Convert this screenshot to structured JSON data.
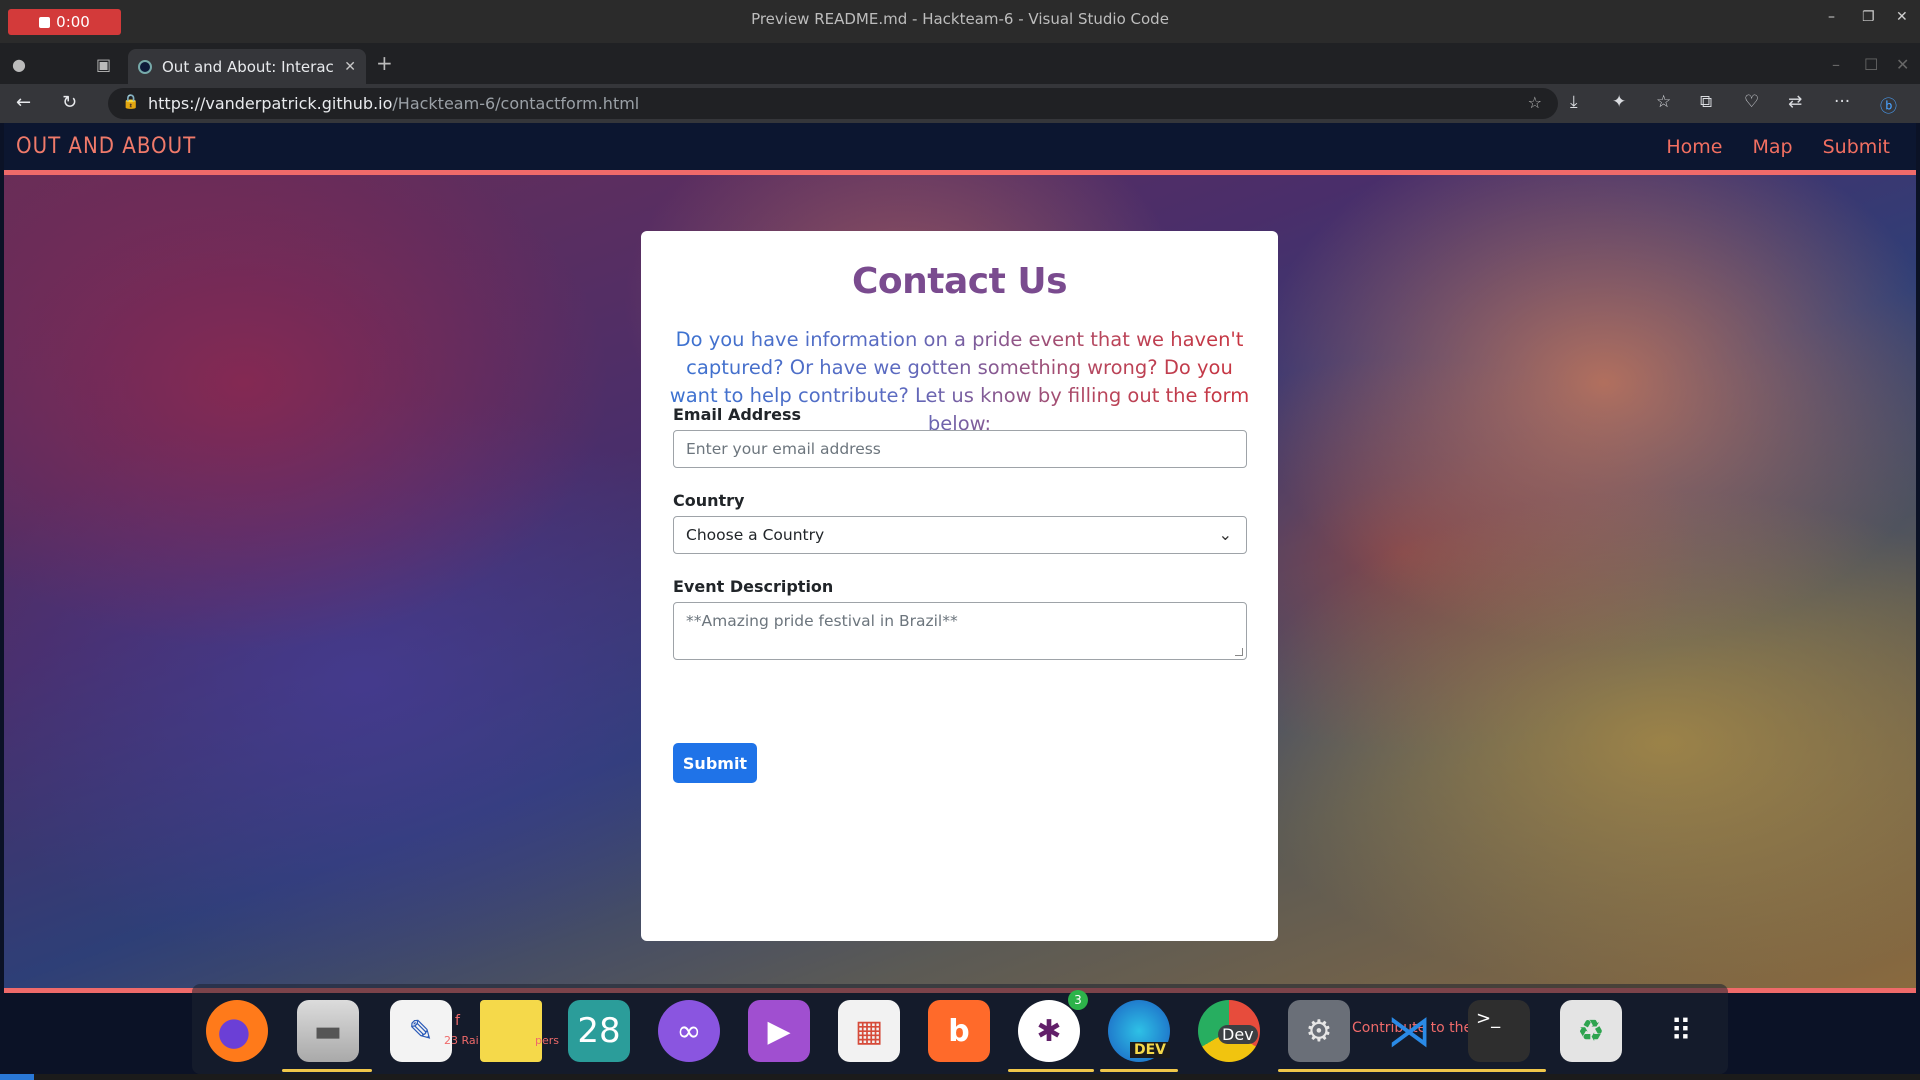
{
  "window": {
    "recording_time": "0:00",
    "title": "Preview README.md - Hackteam-6 - Visual Studio Code"
  },
  "browser": {
    "tab_title": "Out and About: Interacti",
    "url_host": "https://vanderpatrick.github.io",
    "url_path": "/Hackteam-6/contactform.html"
  },
  "site": {
    "brand": "OUT AND ABOUT",
    "nav": [
      "Home",
      "Map",
      "Submit"
    ]
  },
  "form": {
    "title": "Contact Us",
    "intro": "Do you have information on a pride event that we haven't captured? Or have we gotten something wrong? Do you want to help contribute? Let us know by filling out the form below:",
    "email_label": "Email Address",
    "email_placeholder": "Enter your email address",
    "country_label": "Country",
    "country_selected": "Choose a Country",
    "description_label": "Event Description",
    "description_placeholder": "**Amazing pride festival in Brazil**",
    "submit_label": "Submit"
  },
  "dock": {
    "calendar_day": "28",
    "slack_badge": "3",
    "dev_label": "DEV",
    "chrome_dev_label": "Dev",
    "overlay_text_1": "23 Rai",
    "overlay_text_2": "pers",
    "overlay_text_3": "Contribute to the"
  },
  "colors": {
    "nav_bg": "#0c1630",
    "accent": "#ef6a6a",
    "title_purple": "#7a4b8f",
    "submit_blue": "#1f73e8"
  }
}
